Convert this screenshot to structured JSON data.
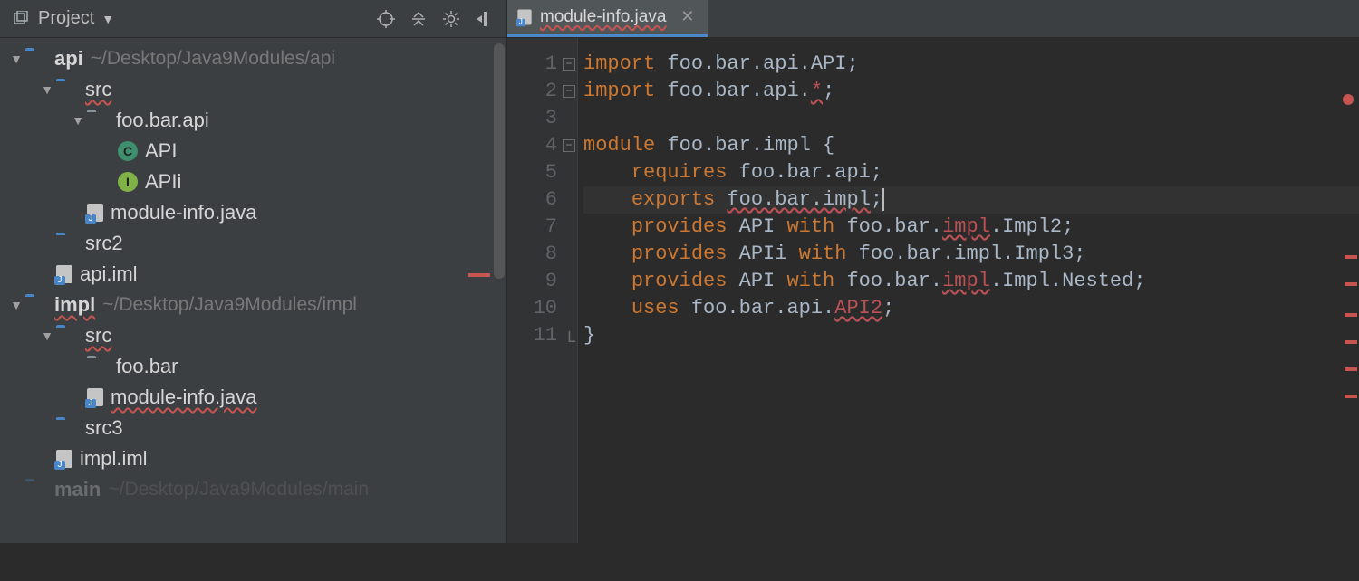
{
  "sidebar": {
    "title": "Project",
    "toolbar_icons": [
      "target-icon",
      "collapse-icon",
      "gear-icon",
      "hide-icon"
    ],
    "tree": [
      {
        "type": "module",
        "name": "api",
        "path": "~/Desktop/Java9Modules/api",
        "expanded": true,
        "children": [
          {
            "type": "src",
            "name": "src",
            "expanded": true,
            "err": true,
            "children": [
              {
                "type": "pkg",
                "name": "foo.bar.api",
                "expanded": true,
                "children": [
                  {
                    "type": "class",
                    "kind": "C",
                    "name": "API"
                  },
                  {
                    "type": "class",
                    "kind": "I",
                    "name": "APIi"
                  }
                ]
              },
              {
                "type": "jfile",
                "name": "module-info.java"
              }
            ]
          },
          {
            "type": "folder",
            "name": "src2"
          },
          {
            "type": "jfile",
            "name": "api.iml"
          }
        ]
      },
      {
        "type": "module",
        "name": "impl",
        "path": "~/Desktop/Java9Modules/impl",
        "err": true,
        "expanded": true,
        "children": [
          {
            "type": "src",
            "name": "src",
            "expanded": true,
            "err": true,
            "children": [
              {
                "type": "pkg",
                "name": "foo.bar",
                "expanded": false
              },
              {
                "type": "jfile",
                "name": "module-info.java",
                "err": true
              }
            ]
          },
          {
            "type": "folder",
            "name": "src3"
          },
          {
            "type": "jfile",
            "name": "impl.iml"
          }
        ]
      },
      {
        "type": "module",
        "name": "main",
        "path": "~/Desktop/Java9Modules/main",
        "expanded": false,
        "cut": true
      }
    ]
  },
  "tab": {
    "label": "module-info.java",
    "err": true
  },
  "code": {
    "lines": [
      [
        {
          "t": "kw",
          "v": "import "
        },
        {
          "t": "txt",
          "v": "foo.bar.api.API;"
        }
      ],
      [
        {
          "t": "kw",
          "v": "import "
        },
        {
          "t": "txt",
          "v": "foo.bar.api."
        },
        {
          "t": "err",
          "v": "*"
        },
        {
          "t": "txt",
          "v": ";"
        }
      ],
      [],
      [
        {
          "t": "kw",
          "v": "module "
        },
        {
          "t": "txt",
          "v": "foo.bar.impl {"
        }
      ],
      [
        {
          "t": "pad",
          "v": "    "
        },
        {
          "t": "kw",
          "v": "requires "
        },
        {
          "t": "txt",
          "v": "foo.bar.api;"
        }
      ],
      [
        {
          "t": "pad",
          "v": "    "
        },
        {
          "t": "kw",
          "v": "exports "
        },
        {
          "t": "warn",
          "v": "foo.bar.impl"
        },
        {
          "t": "txt",
          "v": ";"
        }
      ],
      [
        {
          "t": "pad",
          "v": "    "
        },
        {
          "t": "kw",
          "v": "provides "
        },
        {
          "t": "txt",
          "v": "API "
        },
        {
          "t": "kw",
          "v": "with "
        },
        {
          "t": "txt",
          "v": "foo.bar."
        },
        {
          "t": "err",
          "v": "impl"
        },
        {
          "t": "txt",
          "v": ".Impl2;"
        }
      ],
      [
        {
          "t": "pad",
          "v": "    "
        },
        {
          "t": "kw",
          "v": "provides "
        },
        {
          "t": "txt",
          "v": "APIi "
        },
        {
          "t": "kw",
          "v": "with "
        },
        {
          "t": "txt",
          "v": "foo.bar.impl.Impl3;"
        }
      ],
      [
        {
          "t": "pad",
          "v": "    "
        },
        {
          "t": "kw",
          "v": "provides "
        },
        {
          "t": "txt",
          "v": "API "
        },
        {
          "t": "kw",
          "v": "with "
        },
        {
          "t": "txt",
          "v": "foo.bar."
        },
        {
          "t": "err",
          "v": "impl"
        },
        {
          "t": "txt",
          "v": ".Impl.Nested;"
        }
      ],
      [
        {
          "t": "pad",
          "v": "    "
        },
        {
          "t": "kw",
          "v": "uses "
        },
        {
          "t": "txt",
          "v": "foo.bar.api."
        },
        {
          "t": "err",
          "v": "API2"
        },
        {
          "t": "txt",
          "v": ";"
        }
      ],
      [
        {
          "t": "txt",
          "v": "}"
        }
      ]
    ],
    "highlighted_line": 6,
    "error_strip": [
      198,
      228,
      262,
      292,
      322,
      352
    ],
    "fold_markers": {
      "1": "minus",
      "2": "minus",
      "4": "minus",
      "11": "end"
    }
  }
}
